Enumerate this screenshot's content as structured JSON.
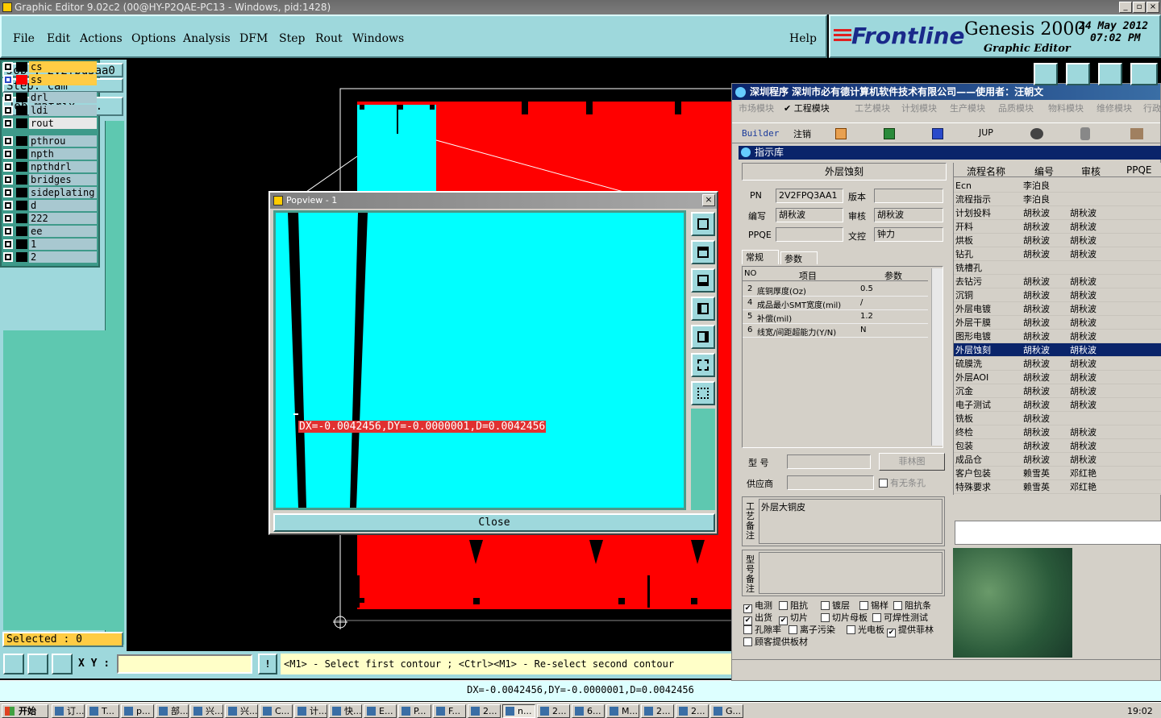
{
  "window": {
    "title": "Graphic Editor 9.02c2 (00@HY-P2QAE-PC13 - Windows, pid:1428)"
  },
  "menu": [
    "File",
    "Edit",
    "Actions",
    "Options",
    "Analysis",
    "DFM",
    "Step",
    "Rout",
    "Windows"
  ],
  "help": "Help",
  "brand": {
    "logo": "Frontline",
    "product": "Genesis 2000",
    "subtitle": "Graphic Editor",
    "date": "24 May 2012",
    "time": "07:02 PM"
  },
  "job": {
    "job_label": "Job : 2v2fpq3aa0",
    "step_label": "Step: cam",
    "matrix_button": "Job Matrix ..."
  },
  "layers": [
    {
      "name": "cs",
      "color": "#ffcc44"
    },
    {
      "name": "ss",
      "color": "#ffcc44"
    },
    {
      "name": "drl",
      "color": "#a8c8d0"
    },
    {
      "name": "ldi",
      "color": "#a8c8d0"
    },
    {
      "name": "rout",
      "color": "#e8e8e8"
    },
    {
      "name": "pthrou",
      "color": "#a8c8d0"
    },
    {
      "name": "npth",
      "color": "#a8c8d0"
    },
    {
      "name": "npthdrl",
      "color": "#a8c8d0"
    },
    {
      "name": "bridges",
      "color": "#a8c8d0"
    },
    {
      "name": "sideplating",
      "color": "#a8c8d0"
    },
    {
      "name": "d",
      "color": "#a8c8d0"
    },
    {
      "name": "222",
      "color": "#a8c8d0"
    },
    {
      "name": "ee",
      "color": "#a8c8d0"
    },
    {
      "name": "1",
      "color": "#a8c8d0"
    },
    {
      "name": "2",
      "color": "#a8c8d0"
    }
  ],
  "selected": "Selected : 0",
  "popview": {
    "title": "Popview - 1",
    "measure": "DX=-0.0042456,DY=-0.0000001,D=0.0042456",
    "close": "Close"
  },
  "bottom": {
    "xy_label": "X Y :",
    "prompt": "<M1> - Select first contour ; <Ctrl><M1> - Re-select second contour"
  },
  "status": "DX=-0.0042456,DY=-0.0000001,D=0.0042456",
  "rw": {
    "title": "深圳程序   深圳市必有德计算机软件技术有限公司——使用者：汪朝文",
    "modules": [
      "市场模块",
      "工程模块",
      "工艺模块",
      "计划模块",
      "生产模块",
      "品质模块",
      "物料模块",
      "维修模块",
      "行政"
    ],
    "toolbar": [
      "Builder",
      "注销",
      "JUP"
    ],
    "lib_title": "指示库",
    "section": "外层蚀刻",
    "pn_label": "PN",
    "pn_value": "2V2FPQ3AA1",
    "ver_label": "版本",
    "editor_label": "编写",
    "editor_value": "胡秋波",
    "review_label": "审核",
    "review_value": "胡秋波",
    "ppqe_label": "PPQE",
    "doc_label": "文控",
    "doc_value": "钟力",
    "tabs": [
      "常规",
      "参数"
    ],
    "param_headers": [
      "NO",
      "项目",
      "参数"
    ],
    "params": [
      {
        "no": "2",
        "item": "底铜厚度(Oz)",
        "val": "0.5"
      },
      {
        "no": "4",
        "item": "成品最小SMT宽度(mil)",
        "val": "/"
      },
      {
        "no": "5",
        "item": "补偿(mil)",
        "val": "1.2"
      },
      {
        "no": "6",
        "item": "线宽/间距超能力(Y/N)",
        "val": "N"
      }
    ],
    "model_label": "型  号",
    "film_button": "菲林图",
    "supplier_label": "供应商",
    "no_hole": "有无条孔",
    "note1_label": "工艺备注",
    "note1_value": "外层大铜皮",
    "note2_label": "型号备注",
    "checks": [
      {
        "label": "电测",
        "on": true
      },
      {
        "label": "阻抗",
        "on": false
      },
      {
        "label": "镀层",
        "on": false
      },
      {
        "label": "锡样",
        "on": false
      },
      {
        "label": "阻抗条",
        "on": false
      },
      {
        "label": "出货",
        "on": true
      },
      {
        "label": "切片",
        "on": true
      },
      {
        "label": "切片母板",
        "on": false
      },
      {
        "label": "可焊性测试",
        "on": false
      },
      {
        "label": "孔隙率",
        "on": false
      },
      {
        "label": "离子污染",
        "on": false
      },
      {
        "label": "光电板",
        "on": false
      },
      {
        "label": "提供菲林",
        "on": true
      },
      {
        "label": "顾客提供板材",
        "on": false
      }
    ],
    "grid_headers": [
      "流程名称",
      "编号",
      "审核",
      "PPQE"
    ],
    "grid": [
      [
        "Ecn",
        "李泊良",
        ""
      ],
      [
        "流程指示",
        "李泊良",
        ""
      ],
      [
        "计划投料",
        "胡秋波",
        "胡秋波"
      ],
      [
        "开料",
        "胡秋波",
        "胡秋波"
      ],
      [
        "烘板",
        "胡秋波",
        "胡秋波"
      ],
      [
        "钻孔",
        "胡秋波",
        "胡秋波"
      ],
      [
        "铣槽孔",
        "",
        ""
      ],
      [
        "去钻污",
        "胡秋波",
        "胡秋波"
      ],
      [
        "沉铜",
        "胡秋波",
        "胡秋波"
      ],
      [
        "外层电镀",
        "胡秋波",
        "胡秋波"
      ],
      [
        "外层干膜",
        "胡秋波",
        "胡秋波"
      ],
      [
        "图形电镀",
        "胡秋波",
        "胡秋波"
      ],
      [
        "外层蚀刻",
        "胡秋波",
        "胡秋波"
      ],
      [
        "硫膜洗",
        "胡秋波",
        "胡秋波"
      ],
      [
        "外层AOI",
        "胡秋波",
        "胡秋波"
      ],
      [
        "沉金",
        "胡秋波",
        "胡秋波"
      ],
      [
        "电子测试",
        "胡秋波",
        "胡秋波"
      ],
      [
        "铣板",
        "胡秋波",
        ""
      ],
      [
        "终检",
        "胡秋波",
        "胡秋波"
      ],
      [
        "包装",
        "胡秋波",
        "胡秋波"
      ],
      [
        "成品仓",
        "胡秋波",
        "胡秋波"
      ],
      [
        "客户包装",
        "赖雪英",
        "邓红艳"
      ],
      [
        "特殊要求",
        "赖雪英",
        "邓红艳"
      ]
    ],
    "selected_row": 12
  },
  "taskbar": {
    "start": "开始",
    "time": "19:02",
    "items": [
      "订...",
      "T...",
      "p...",
      "部...",
      "兴...",
      "兴...",
      "C...",
      "计...",
      "快...",
      "E...",
      "P...",
      "F...",
      "2...",
      "n...",
      "2...",
      "6...",
      "M...",
      "2...",
      "2...",
      "G..."
    ]
  }
}
